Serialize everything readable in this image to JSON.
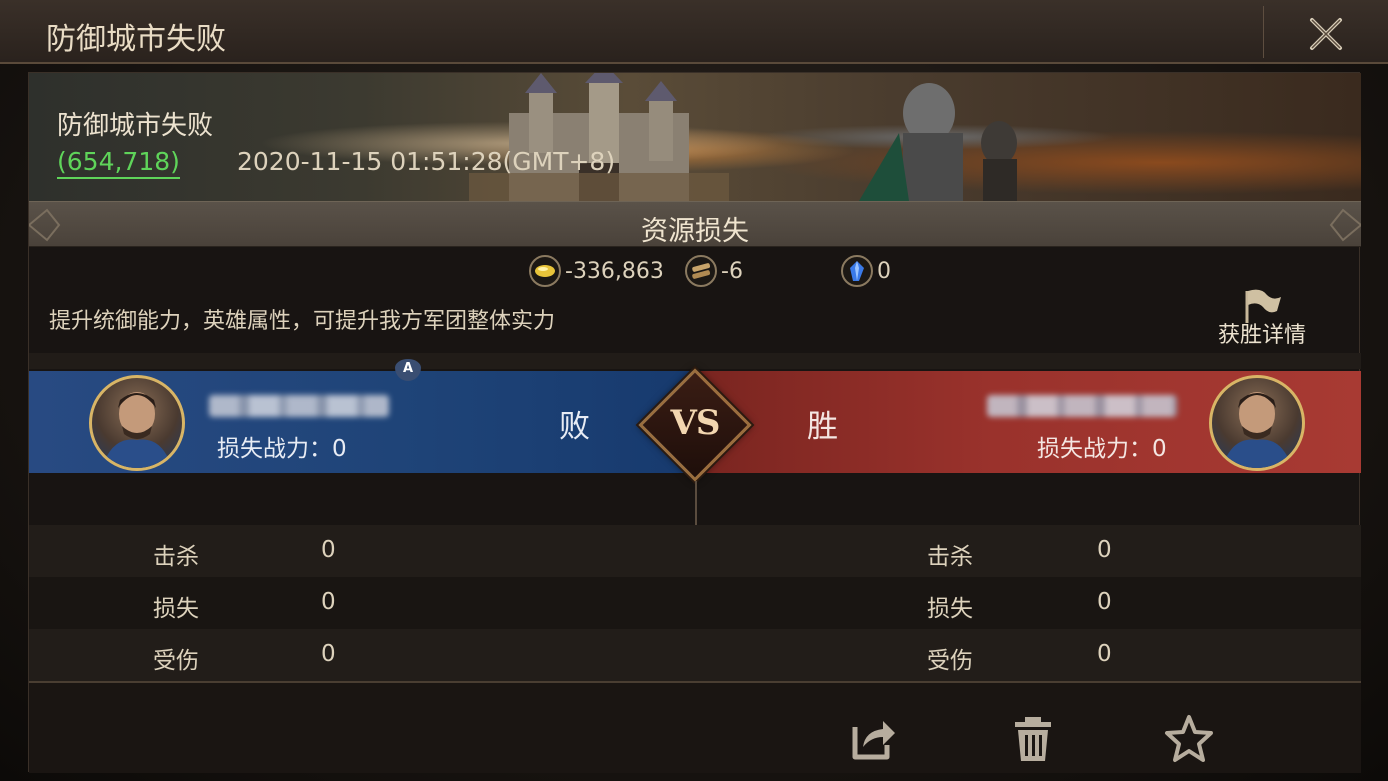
{
  "window": {
    "title": "防御城市失败"
  },
  "banner": {
    "title": "防御城市失败",
    "power": "(654,718)",
    "timestamp": "2020-11-15 01:51:28(GMT+8)"
  },
  "resources": {
    "header": "资源损失",
    "items": [
      {
        "icon": "gold-icon",
        "value": "-336,863"
      },
      {
        "icon": "wood-icon",
        "value": "-6"
      },
      {
        "icon": "crystal-icon",
        "value": "0"
      }
    ]
  },
  "tip": "提升统御能力，英雄属性，可提升我方军团整体实力",
  "victory_details": {
    "label": "获胜详情"
  },
  "battle": {
    "marker": "A",
    "vs": "VS",
    "left": {
      "result": "败",
      "loss_power": "损失战力：0",
      "color": "#1f4478"
    },
    "right": {
      "result": "胜",
      "loss_power": "损失战力：0",
      "color": "#9a322c"
    }
  },
  "stats": {
    "left": [
      {
        "label": "击杀",
        "value": "0"
      },
      {
        "label": "损失",
        "value": "0"
      },
      {
        "label": "受伤",
        "value": "0"
      }
    ],
    "right": [
      {
        "label": "击杀",
        "value": "0"
      },
      {
        "label": "损失",
        "value": "0"
      },
      {
        "label": "受伤",
        "value": "0"
      }
    ]
  },
  "footer": {
    "buttons": [
      "share-icon",
      "trash-icon",
      "star-icon"
    ]
  },
  "colors": {
    "accent_green": "#5fd45a",
    "gold_border": "#d8b566"
  }
}
